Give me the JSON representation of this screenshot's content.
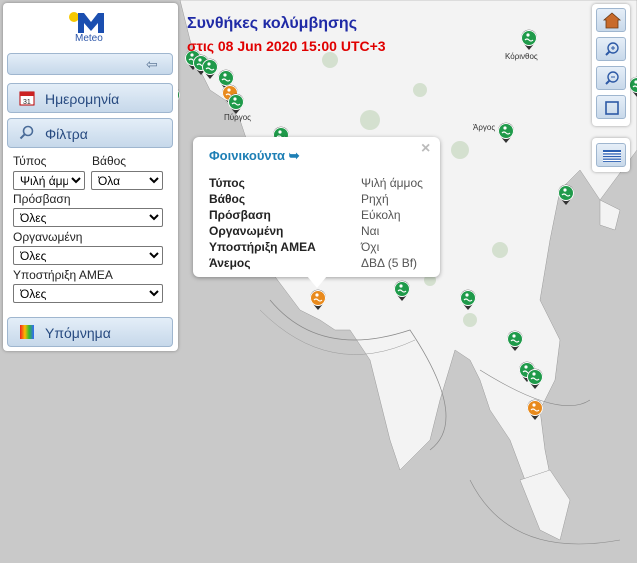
{
  "header": {
    "title": "Συνθήκες κολύμβησης",
    "subtitle": "στις 08 Jun 2020 15:00 UTC+3"
  },
  "logo": {
    "text": "Meteo"
  },
  "panel": {
    "date_label": "Ημερομηνία",
    "filters_label": "Φίλτρα",
    "legend_label": "Υπόμνημα",
    "filters": {
      "type": {
        "label": "Τύπος",
        "value": "Ψιλή άμμ"
      },
      "depth": {
        "label": "Βάθος",
        "value": "Όλα"
      },
      "access": {
        "label": "Πρόσβαση",
        "value": "Όλες"
      },
      "organized": {
        "label": "Οργανωμένη",
        "value": "Όλες"
      },
      "amea": {
        "label": "Υποστήριξη ΑΜΕΑ",
        "value": "Όλες"
      }
    }
  },
  "popup": {
    "title": "Φοινικούντα",
    "rows": [
      {
        "key": "Τύπος",
        "value": "Ψιλή άμμος"
      },
      {
        "key": "Βάθος",
        "value": "Ρηχή"
      },
      {
        "key": "Πρόσβαση",
        "value": "Εύκολη"
      },
      {
        "key": "Οργανωμένη",
        "value": "Ναι"
      },
      {
        "key": "Υποστήριξη ΑΜΕΑ",
        "value": "Όχι"
      },
      {
        "key": "Άνεμος",
        "value": "ΔΒΔ (5 Bf)"
      }
    ],
    "close": "×"
  },
  "places": [
    "Κόρινθος",
    "Πύργος",
    "Άργος"
  ],
  "colors": {
    "good": "#1f9a4a",
    "medium": "#e88a1d",
    "land": "#f3f3f3",
    "sea": "#c9c9c9"
  }
}
